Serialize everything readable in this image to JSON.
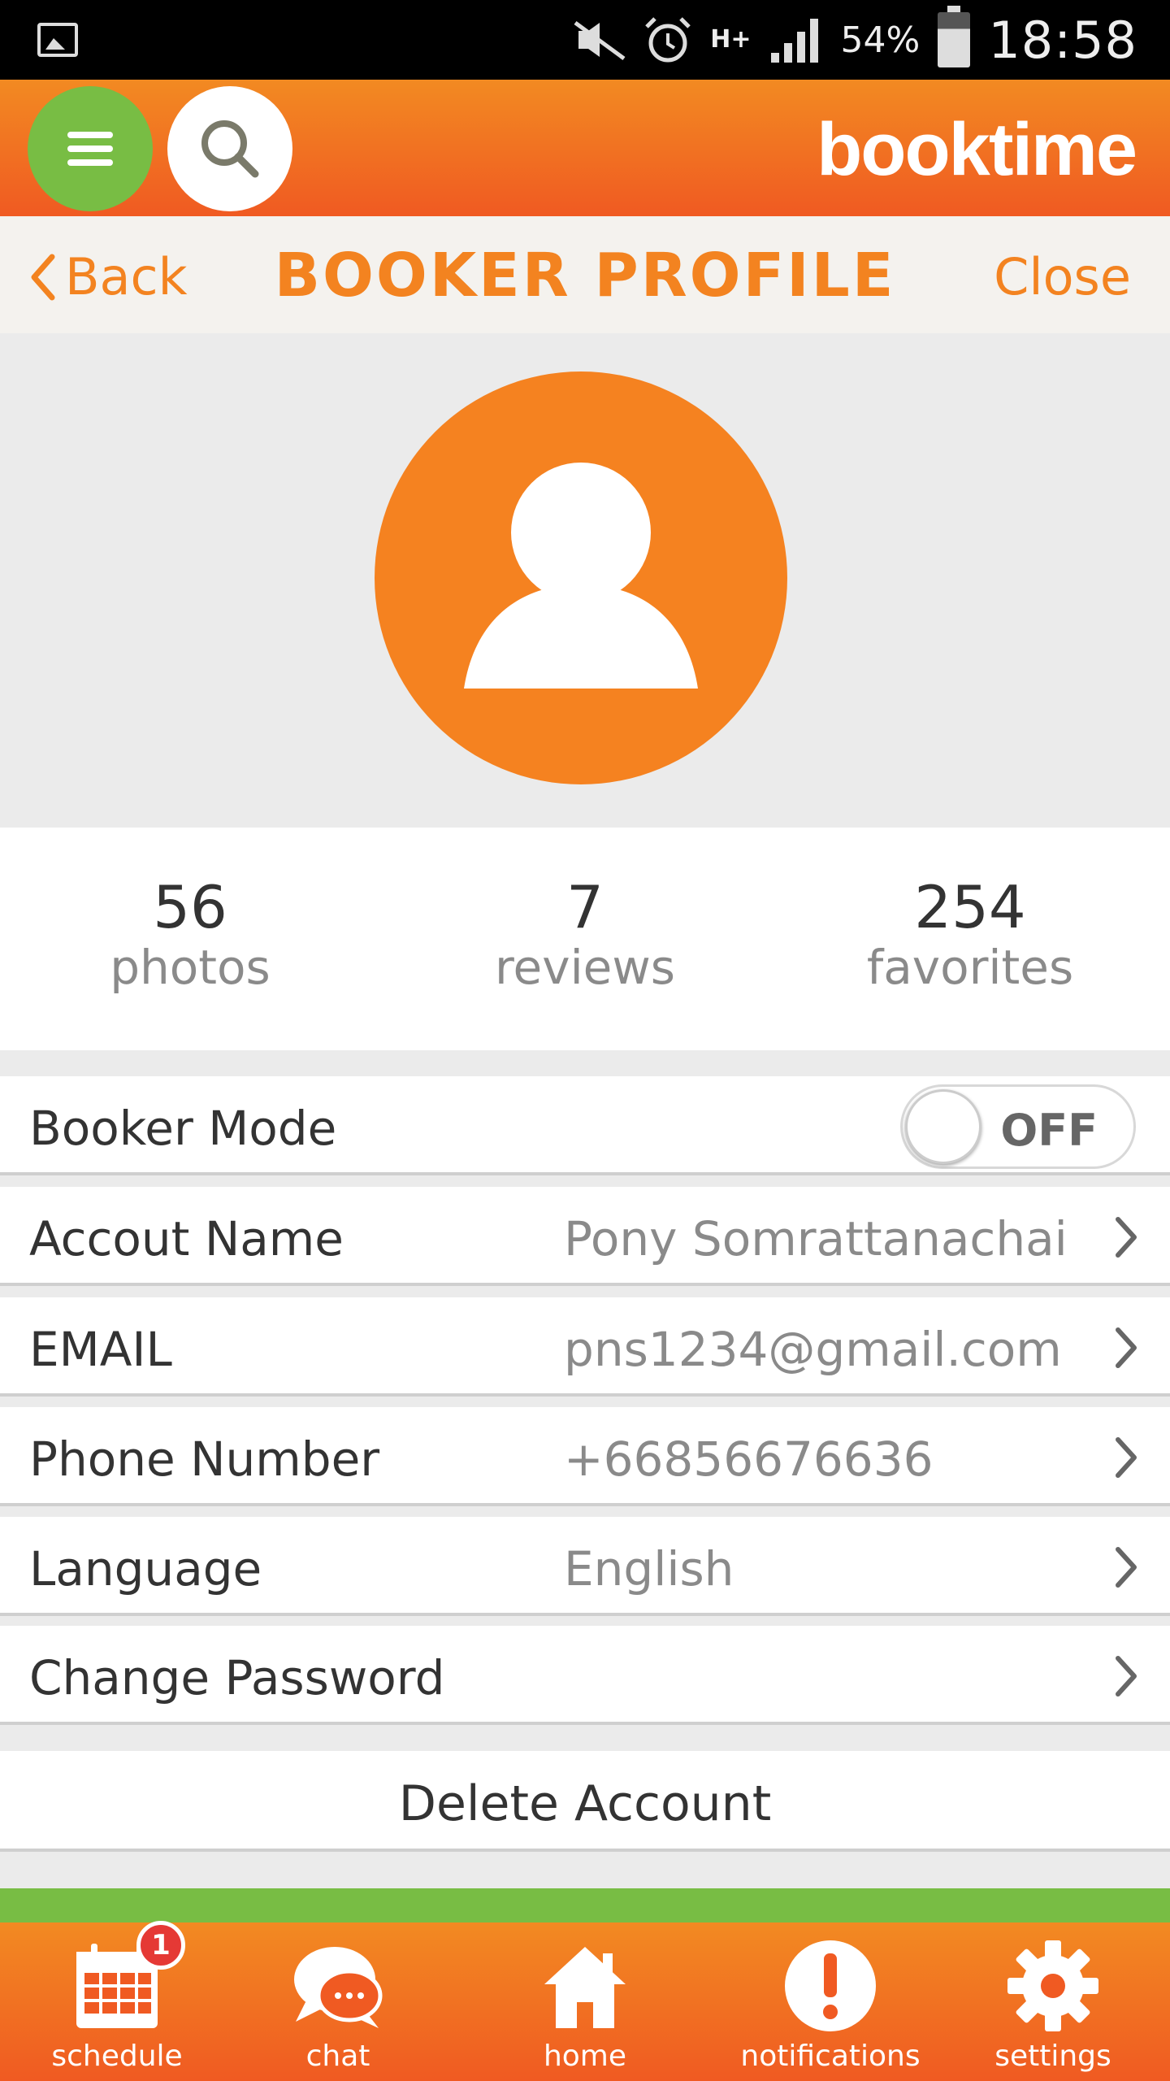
{
  "status_bar": {
    "network": "H+",
    "battery": "54%",
    "time": "18:58"
  },
  "app": {
    "brand": "booktime"
  },
  "nav": {
    "back_label": "Back",
    "title": "BOOKER PROFILE",
    "close_label": "Close"
  },
  "stats": [
    {
      "value": "56",
      "label": "photos"
    },
    {
      "value": "7",
      "label": "reviews"
    },
    {
      "value": "254",
      "label": "favorites"
    }
  ],
  "booker_mode": {
    "label": "Booker Mode",
    "state": "OFF"
  },
  "fields": [
    {
      "label": "Accout Name",
      "value": "Pony Somrattanachai"
    },
    {
      "label": "EMAIL",
      "value": "pns1234@gmail.com"
    },
    {
      "label": "Phone Number",
      "value": "+66856676636"
    },
    {
      "label": "Language",
      "value": "English"
    },
    {
      "label": "Change Password",
      "value": ""
    }
  ],
  "delete_label": "Delete Account",
  "tabs": [
    {
      "label": "schedule",
      "icon": "calendar-icon"
    },
    {
      "label": "chat",
      "icon": "chat-icon"
    },
    {
      "label": "home",
      "icon": "home-icon"
    },
    {
      "label": "notifications",
      "icon": "alert-icon"
    },
    {
      "label": "settings",
      "icon": "gear-icon"
    }
  ],
  "schedule_badge": "1",
  "colors": {
    "brand_orange": "#f58220",
    "green": "#78bd44"
  }
}
